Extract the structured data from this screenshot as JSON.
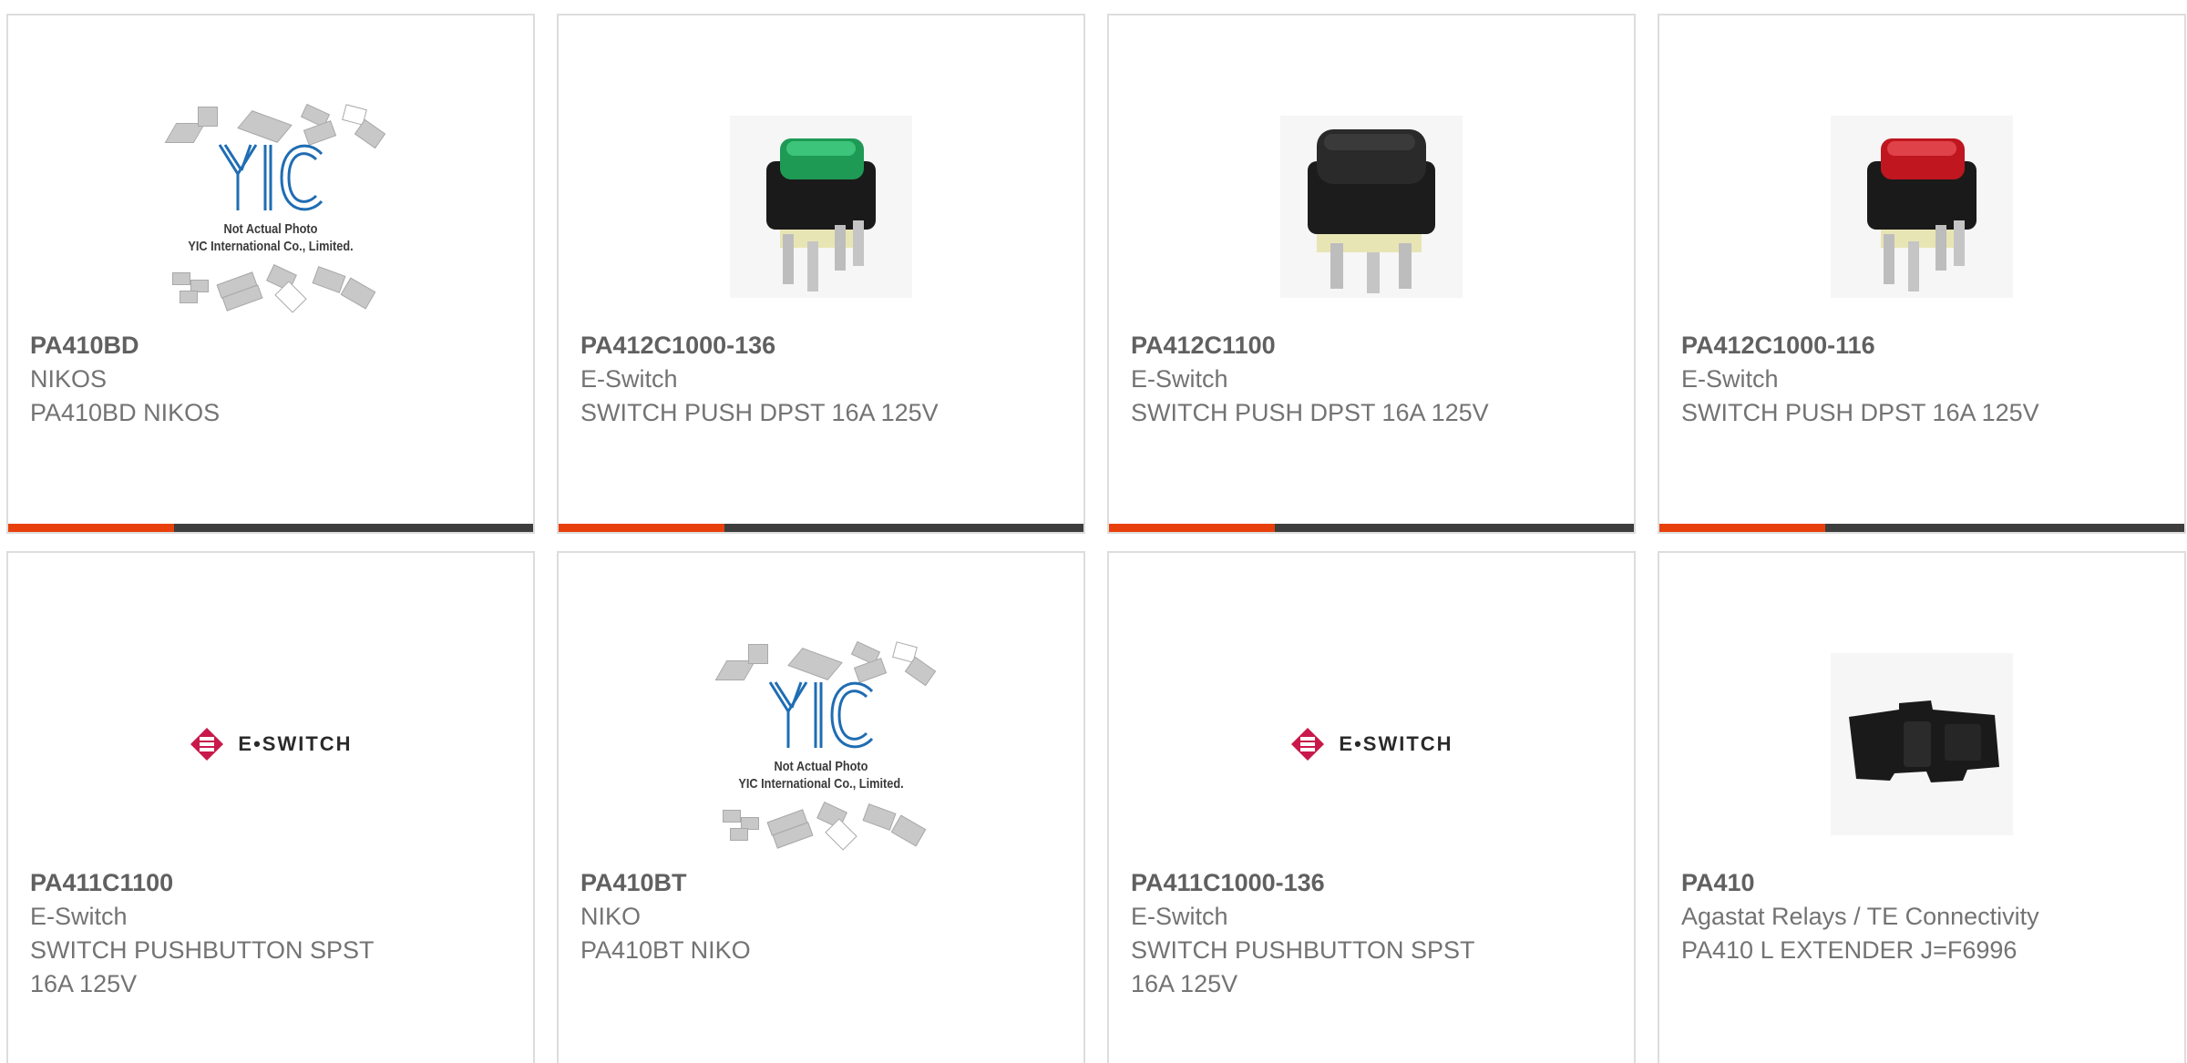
{
  "colors": {
    "accent": "#e8400c",
    "bar": "#3d3d3d",
    "card_border": "#dddddd",
    "part_number": "#606060",
    "text": "#737373",
    "eswitch_brand": "#c8194a"
  },
  "placeholder": {
    "line1": "Not Actual Photo",
    "line2": "YIC International Co., Limited.",
    "logo": "YIC"
  },
  "eswitch_logo": {
    "text": "E•SWITCH"
  },
  "products": [
    {
      "part_number": "PA410BD",
      "manufacturer": "NIKOS",
      "description": "PA410BD NIKOS",
      "image": "placeholder-icon"
    },
    {
      "part_number": "PA412C1000-136",
      "manufacturer": "E-Switch",
      "description": "SWITCH PUSH DPST 16A 125V",
      "image": "green-switch"
    },
    {
      "part_number": "PA412C1100",
      "manufacturer": "E-Switch",
      "description": "SWITCH PUSH DPST 16A 125V",
      "image": "black-switch"
    },
    {
      "part_number": "PA412C1000-116",
      "manufacturer": "E-Switch",
      "description": "SWITCH PUSH DPST 16A 125V",
      "image": "red-switch"
    },
    {
      "part_number": "PA411C1100",
      "manufacturer": "E-Switch",
      "description": "SWITCH PUSHBUTTON SPST 16A 125V",
      "image": "eswitch-logo"
    },
    {
      "part_number": "PA410BT",
      "manufacturer": "NIKO",
      "description": "PA410BT NIKO",
      "image": "placeholder-icon"
    },
    {
      "part_number": "PA411C1000-136",
      "manufacturer": "E-Switch",
      "description": "SWITCH PUSHBUTTON SPST 16A 125V",
      "image": "eswitch-logo"
    },
    {
      "part_number": "PA410",
      "manufacturer": "Agastat Relays / TE Connectivity",
      "description": "PA410 L EXTENDER J=F6996",
      "image": "extender-part"
    }
  ]
}
